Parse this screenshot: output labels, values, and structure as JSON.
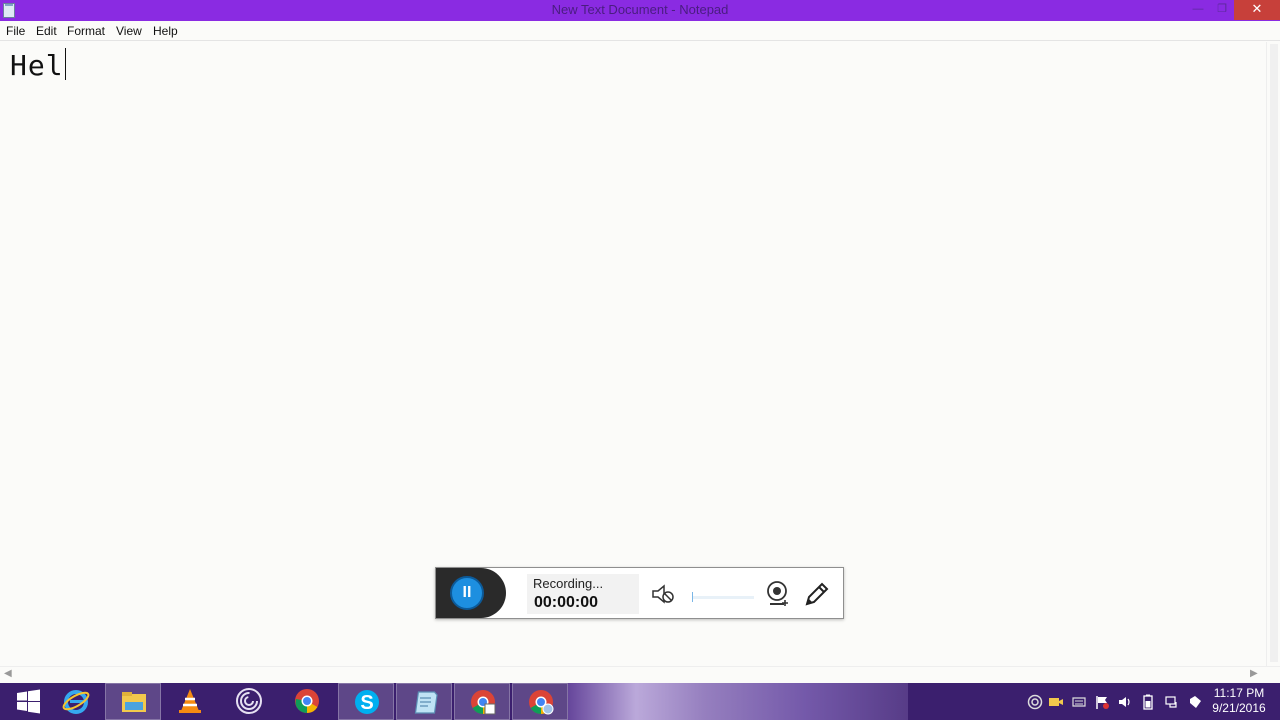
{
  "window": {
    "title": "New Text Document - Notepad",
    "minimize_glyph": "—",
    "maximize_glyph": "❐",
    "close_glyph": "✕"
  },
  "menu": {
    "file": "File",
    "edit": "Edit",
    "format": "Format",
    "view": "View",
    "help": "Help"
  },
  "editor": {
    "content": "Hel"
  },
  "recorder": {
    "status": "Recording...",
    "elapsed": "00:00:00",
    "pause_glyph": "II",
    "volume_level": 0.02,
    "icons": [
      "pause-icon",
      "mic-muted-icon",
      "webcam-add-icon",
      "pen-icon"
    ]
  },
  "taskbar": {
    "items": [
      {
        "name": "start-button",
        "icon": "windows-logo-icon"
      },
      {
        "name": "internet-explorer",
        "icon": "ie-icon"
      },
      {
        "name": "file-explorer",
        "icon": "folder-icon"
      },
      {
        "name": "vlc",
        "icon": "vlc-cone-icon"
      },
      {
        "name": "app-c",
        "icon": "circle-c-icon"
      },
      {
        "name": "chrome",
        "icon": "chrome-icon"
      },
      {
        "name": "skype",
        "icon": "skype-icon"
      },
      {
        "name": "notepad",
        "icon": "notepad-icon"
      },
      {
        "name": "chrome-window-1",
        "icon": "chrome-icon"
      },
      {
        "name": "chrome-window-2",
        "icon": "chrome-icon"
      }
    ],
    "tray_icons": [
      "app-c-tray-icon",
      "camera-tray-icon",
      "keyboard-tray-icon",
      "flag-tray-icon",
      "speaker-tray-icon",
      "battery-tray-icon",
      "network-tray-icon",
      "notes-tray-icon"
    ],
    "clock_time": "11:17 PM",
    "clock_date": "9/21/2016"
  },
  "colors": {
    "titlebar": "#8a2be2",
    "taskbar": "#3b1f6e",
    "accent_blue": "#1d8fe0",
    "close": "#c7403a"
  }
}
